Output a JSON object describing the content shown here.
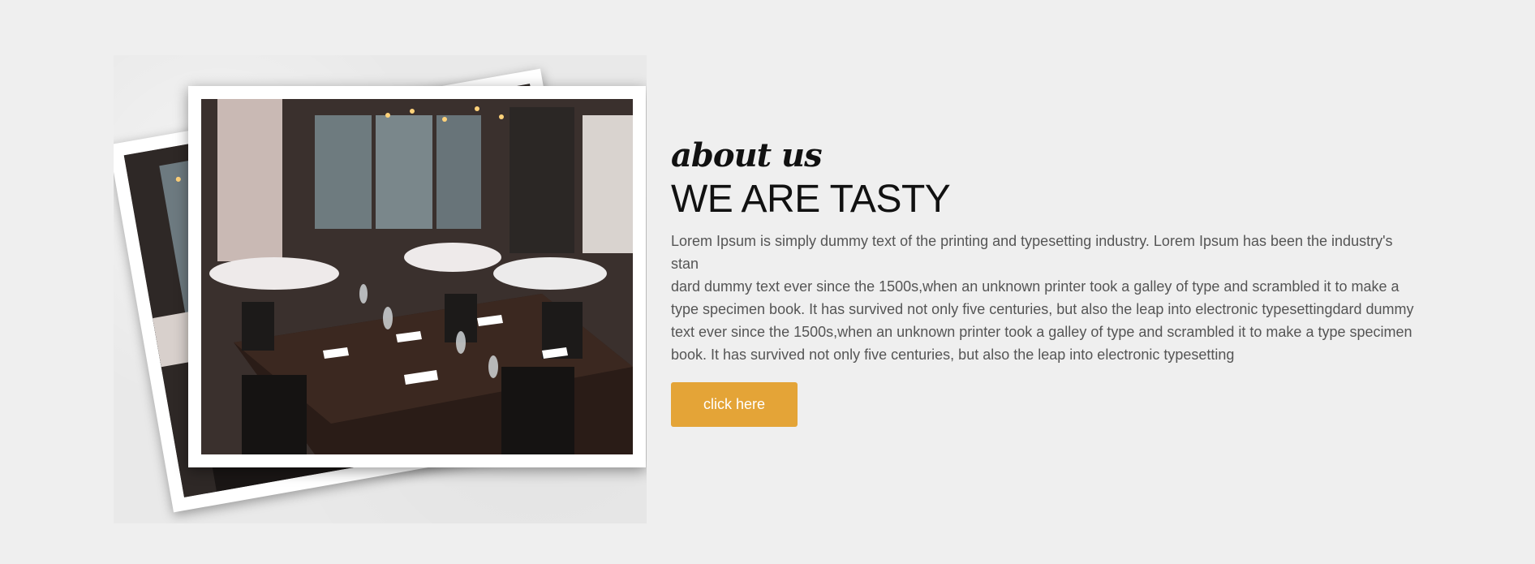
{
  "about": {
    "eyebrow": "about us",
    "heading": "WE ARE TASTY",
    "paragraph_lines": [
      "Lorem Ipsum is simply dummy text of the printing and typesetting industry. Lorem Ipsum has been the industry's stan",
      "dard dummy text ever since the 1500s,when an unknown printer took a galley of type and scrambled it to make a type specimen book. It has survived not only five centuries, but also the leap into electronic typesettingdard dummy text ever since the 1500s,when an unknown printer took a galley of type and scrambled it to make a type specimen book. It has survived not only five centuries, but also the leap into electronic typesetting"
    ],
    "button_label": "click here"
  },
  "colors": {
    "background": "#efefef",
    "accent": "#e4a437",
    "heading": "#111111",
    "body_text": "#555555"
  },
  "images": {
    "back_photo": "restaurant-interior-photo",
    "front_photo": "restaurant-interior-photo"
  }
}
